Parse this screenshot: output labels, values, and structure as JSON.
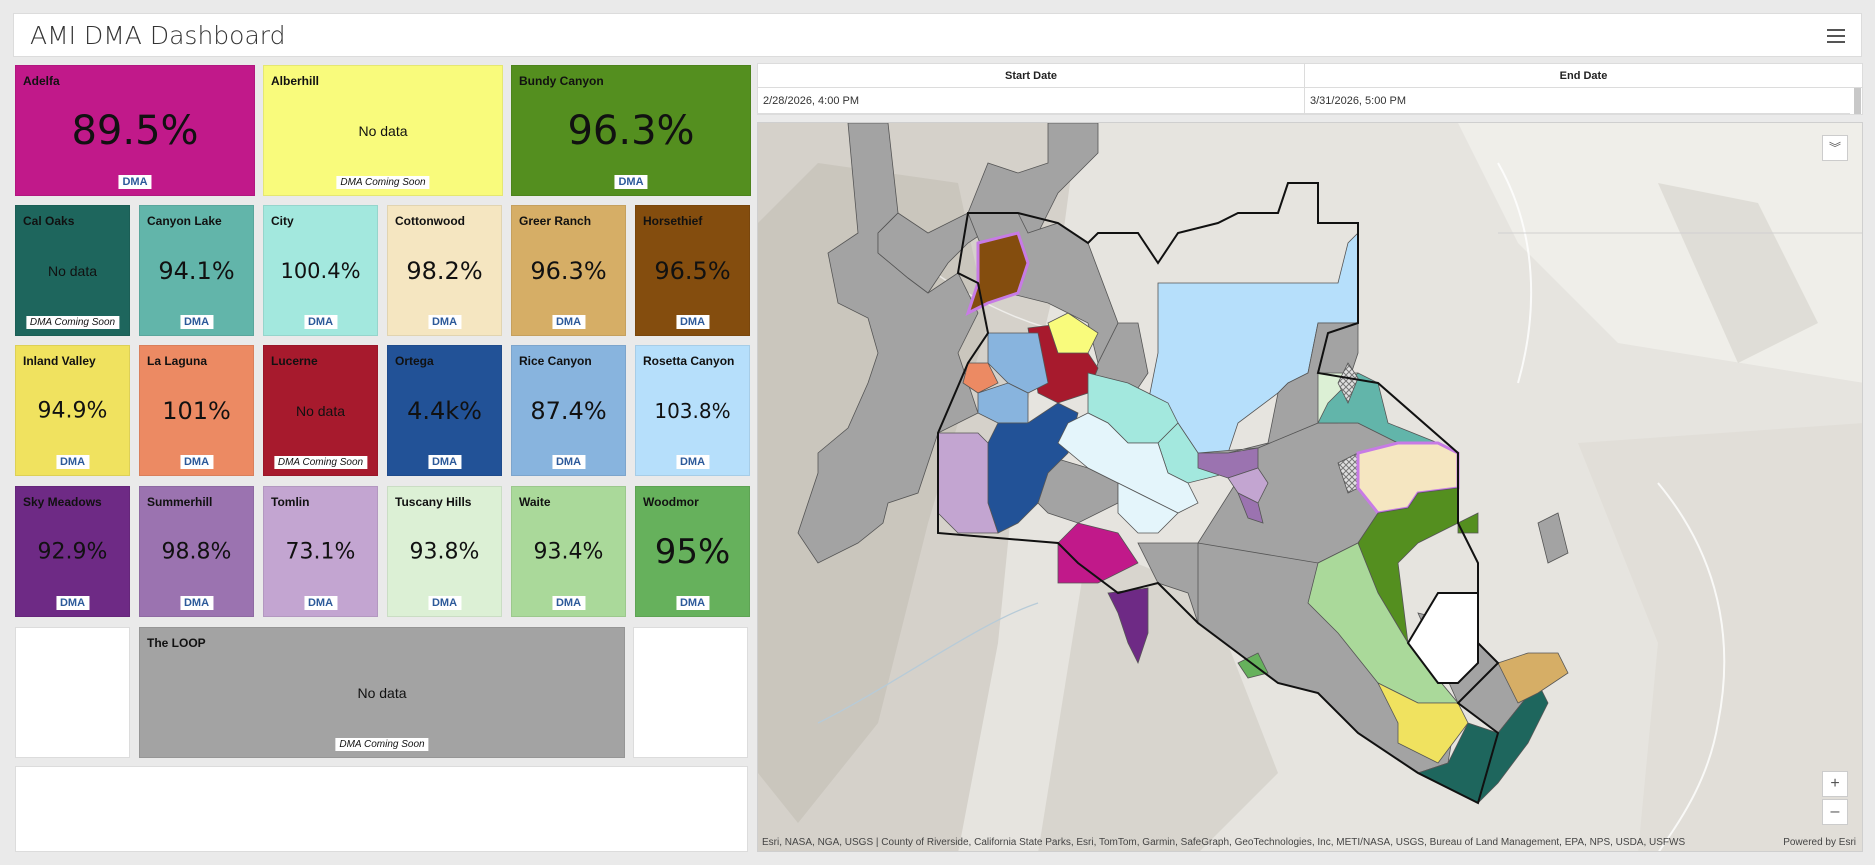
{
  "header": {
    "title": "AMI DMA Dashboard",
    "menu_icon": "hamburger-menu-icon"
  },
  "tiles": [
    {
      "name": "Adelfa",
      "value": "89.5%",
      "badge": "DMA",
      "color": "#c1198a",
      "textColor": "#111"
    },
    {
      "name": "Alberhill",
      "value": "No data",
      "badge": "DMA Coming Soon",
      "color": "#f9fb7c",
      "textColor": "#111"
    },
    {
      "name": "Bundy Canyon",
      "value": "96.3%",
      "badge": "DMA",
      "color": "#548f1f",
      "textColor": "#111"
    },
    {
      "name": "Cal Oaks",
      "value": "No data",
      "badge": "DMA Coming Soon",
      "color": "#1e665d",
      "textColor": "#111"
    },
    {
      "name": "Canyon Lake",
      "value": "94.1%",
      "badge": "DMA",
      "color": "#62b5aa",
      "textColor": "#111"
    },
    {
      "name": "City",
      "value": "100.4%",
      "badge": "DMA",
      "color": "#a3e8de",
      "textColor": "#111"
    },
    {
      "name": "Cottonwood",
      "value": "98.2%",
      "badge": "DMA",
      "color": "#f5e6c1",
      "textColor": "#111"
    },
    {
      "name": "Greer Ranch",
      "value": "96.3%",
      "badge": "DMA",
      "color": "#d6ae66",
      "textColor": "#111"
    },
    {
      "name": "Horsethief",
      "value": "96.5%",
      "badge": "DMA",
      "color": "#844d0e",
      "textColor": "#111"
    },
    {
      "name": "Inland Valley",
      "value": "94.9%",
      "badge": "DMA",
      "color": "#f0e25f",
      "textColor": "#111"
    },
    {
      "name": "La Laguna",
      "value": "101%",
      "badge": "DMA",
      "color": "#ec8a63",
      "textColor": "#111"
    },
    {
      "name": "Lucerne",
      "value": "No data",
      "badge": "DMA Coming Soon",
      "color": "#a71a2d",
      "textColor": "#111"
    },
    {
      "name": "Ortega",
      "value": "4.4k%",
      "badge": "DMA",
      "color": "#225297",
      "textColor": "#111"
    },
    {
      "name": "Rice Canyon",
      "value": "87.4%",
      "badge": "DMA",
      "color": "#88b4de",
      "textColor": "#111"
    },
    {
      "name": "Rosetta Canyon",
      "value": "103.8%",
      "badge": "DMA",
      "color": "#b6dffb",
      "textColor": "#111"
    },
    {
      "name": "Sky Meadows",
      "value": "92.9%",
      "badge": "DMA",
      "color": "#6e2a85",
      "textColor": "#111"
    },
    {
      "name": "Summerhill",
      "value": "98.8%",
      "badge": "DMA",
      "color": "#9b73b0",
      "textColor": "#111"
    },
    {
      "name": "Tomlin",
      "value": "73.1%",
      "badge": "DMA",
      "color": "#c3a5d1",
      "textColor": "#111"
    },
    {
      "name": "Tuscany Hills",
      "value": "93.8%",
      "badge": "DMA",
      "color": "#dcf0d5",
      "textColor": "#111"
    },
    {
      "name": "Waite",
      "value": "93.4%",
      "badge": "DMA",
      "color": "#aad99a",
      "textColor": "#111"
    },
    {
      "name": "Woodmor",
      "value": "95%",
      "badge": "DMA",
      "color": "#66b15c",
      "textColor": "#111"
    },
    {
      "name": "The LOOP",
      "value": "No data",
      "badge": "DMA Coming Soon",
      "color": "#a3a3a3",
      "textColor": "#111"
    }
  ],
  "dates": {
    "start_label": "Start Date",
    "end_label": "End Date",
    "start_value": "2/28/2026, 4:00 PM",
    "end_value": "3/31/2026, 5:00 PM"
  },
  "map": {
    "attribution": "Esri, NASA, NGA, USGS | County of Riverside, California State Parks, Esri, TomTom, Garmin, SafeGraph, GeoTechnologies, Inc, METI/NASA, USGS, Bureau of Land Management, EPA, NPS, USDA, USFWS",
    "powered_by": "Powered by Esri",
    "zoom_in": "+",
    "zoom_out": "–",
    "collapse_icon": "chevron-double-down-icon"
  }
}
